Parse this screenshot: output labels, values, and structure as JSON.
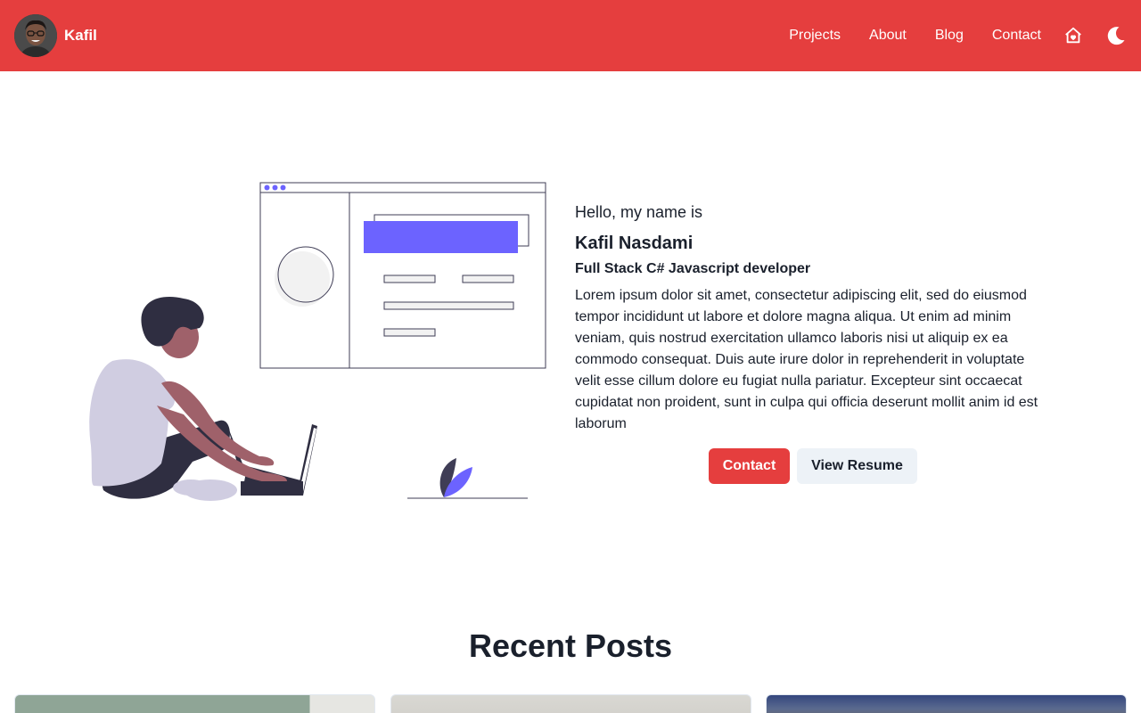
{
  "header": {
    "brand_name": "Kafil",
    "nav": [
      "Projects",
      "About",
      "Blog",
      "Contact"
    ],
    "icons": [
      "home-heart-icon",
      "moon-icon"
    ],
    "background": "#e53e3e"
  },
  "hero": {
    "greeting": "Hello, my name is",
    "name": "Kafil Nasdami",
    "role": "Full Stack C# Javascript developer",
    "bio": "Lorem ipsum dolor sit amet, consectetur adipiscing elit, sed do eiusmod tempor incididunt ut labore et dolore magna aliqua. Ut enim ad minim veniam, quis nostrud exercitation ullamco laboris nisi ut aliquip ex ea commodo consequat. Duis aute irure dolor in reprehenderit in voluptate velit esse cillum dolore eu fugiat nulla pariatur. Excepteur sint occaecat cupidatat non proident, sunt in culpa qui officia deserunt mollit anim id est laborum",
    "primary_button": "Contact",
    "secondary_button": "View Resume",
    "accent": "#6c63ff"
  },
  "recent_posts": {
    "title": "Recent Posts"
  }
}
